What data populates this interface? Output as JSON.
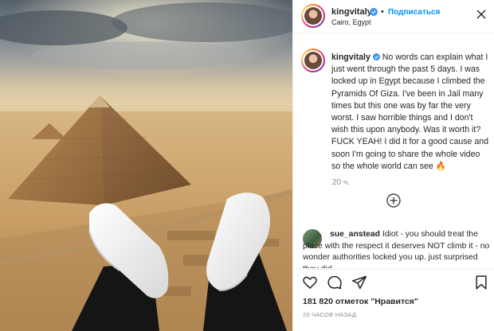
{
  "post": {
    "username": "kingvitaly",
    "dot": "•",
    "follow_label": "Подписаться",
    "location": "Cairo, Egypt",
    "caption": "No words can explain what I just went through the past 5 days. I was locked up in Egypt because I climbed the Pyramids Of Giza. I've been in Jail many times but this one was by far the very worst. I saw horrible things and I don't wish this upon anybody. Was it worth it? FUCK YEAH! I did it for a good cause and soon I'm going to share the whole video so the whole world can see",
    "caption_emoji": "🔥",
    "time_ago": "20 ч.",
    "likes": "181 820 отметок \"Нравится\"",
    "posted_ago": "20 ЧАСОВ НАЗАД"
  },
  "comment": {
    "username": "sue_anstead",
    "text": "Idiot - you should treat the place with the respect it deserves NOT climb it - no wonder authorities locked you up. just surprised they did"
  },
  "icons": {
    "verified": "verified-badge-icon",
    "more": "more-options-icon",
    "load_more": "load-more-plus-icon",
    "like": "heart-icon",
    "comment": "comment-bubble-icon",
    "share": "paper-plane-icon",
    "save": "bookmark-icon"
  },
  "colors": {
    "link_blue": "#0095f6",
    "verified_blue": "#3897f0",
    "muted": "#8e8e8e",
    "text": "#262626"
  }
}
